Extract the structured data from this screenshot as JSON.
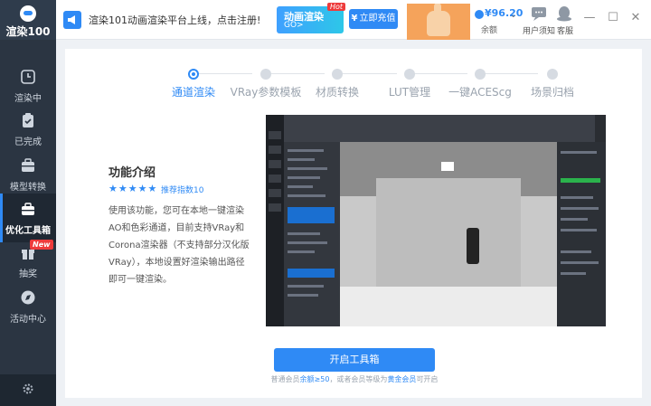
{
  "app": {
    "logo_text": "渲染100"
  },
  "sidebar": {
    "items": [
      {
        "label": "渲染中"
      },
      {
        "label": "已完成"
      },
      {
        "label": "模型转换"
      },
      {
        "label": "优化工具箱"
      },
      {
        "label": "抽奖",
        "badge": "New"
      },
      {
        "label": "活动中心"
      }
    ]
  },
  "topbar": {
    "notice": "渲染101动画渲染平台上线，点击注册!",
    "promo_title": "动画渲染",
    "promo_sub": "GO>",
    "hot_badge": "Hot",
    "recharge_label": "立即充值",
    "balance_value": "¥96.20",
    "balance_label": "余额",
    "user_notice_label": "用户须知",
    "service_label": "客服"
  },
  "steps": [
    {
      "label": "通道渲染",
      "active": true
    },
    {
      "label": "VRay参数模板"
    },
    {
      "label": "材质转换"
    },
    {
      "label": "LUT管理"
    },
    {
      "label": "一键ACEScg"
    },
    {
      "label": "场景归档"
    }
  ],
  "feature": {
    "title": "功能介绍",
    "stars": "★★★★★",
    "recommend": "推荐指数10",
    "description": "使用该功能，您可在本地一键渲染AO和色彩通道，目前支持VRay和Corona渲染器（不支持部分汉化版VRay），本地设置好渲染输出路径即可一键渲染。"
  },
  "action": {
    "open_label": "开启工具箱",
    "tip_prefix": "普通会员",
    "tip_balance": "余额≥50",
    "tip_middle": "，或者会员等级为",
    "tip_member": "黄金会员",
    "tip_suffix": "可开启"
  },
  "colors": {
    "accent": "#2f8af5",
    "sidebar": "#2b3542",
    "badge": "#ee3b3b"
  }
}
